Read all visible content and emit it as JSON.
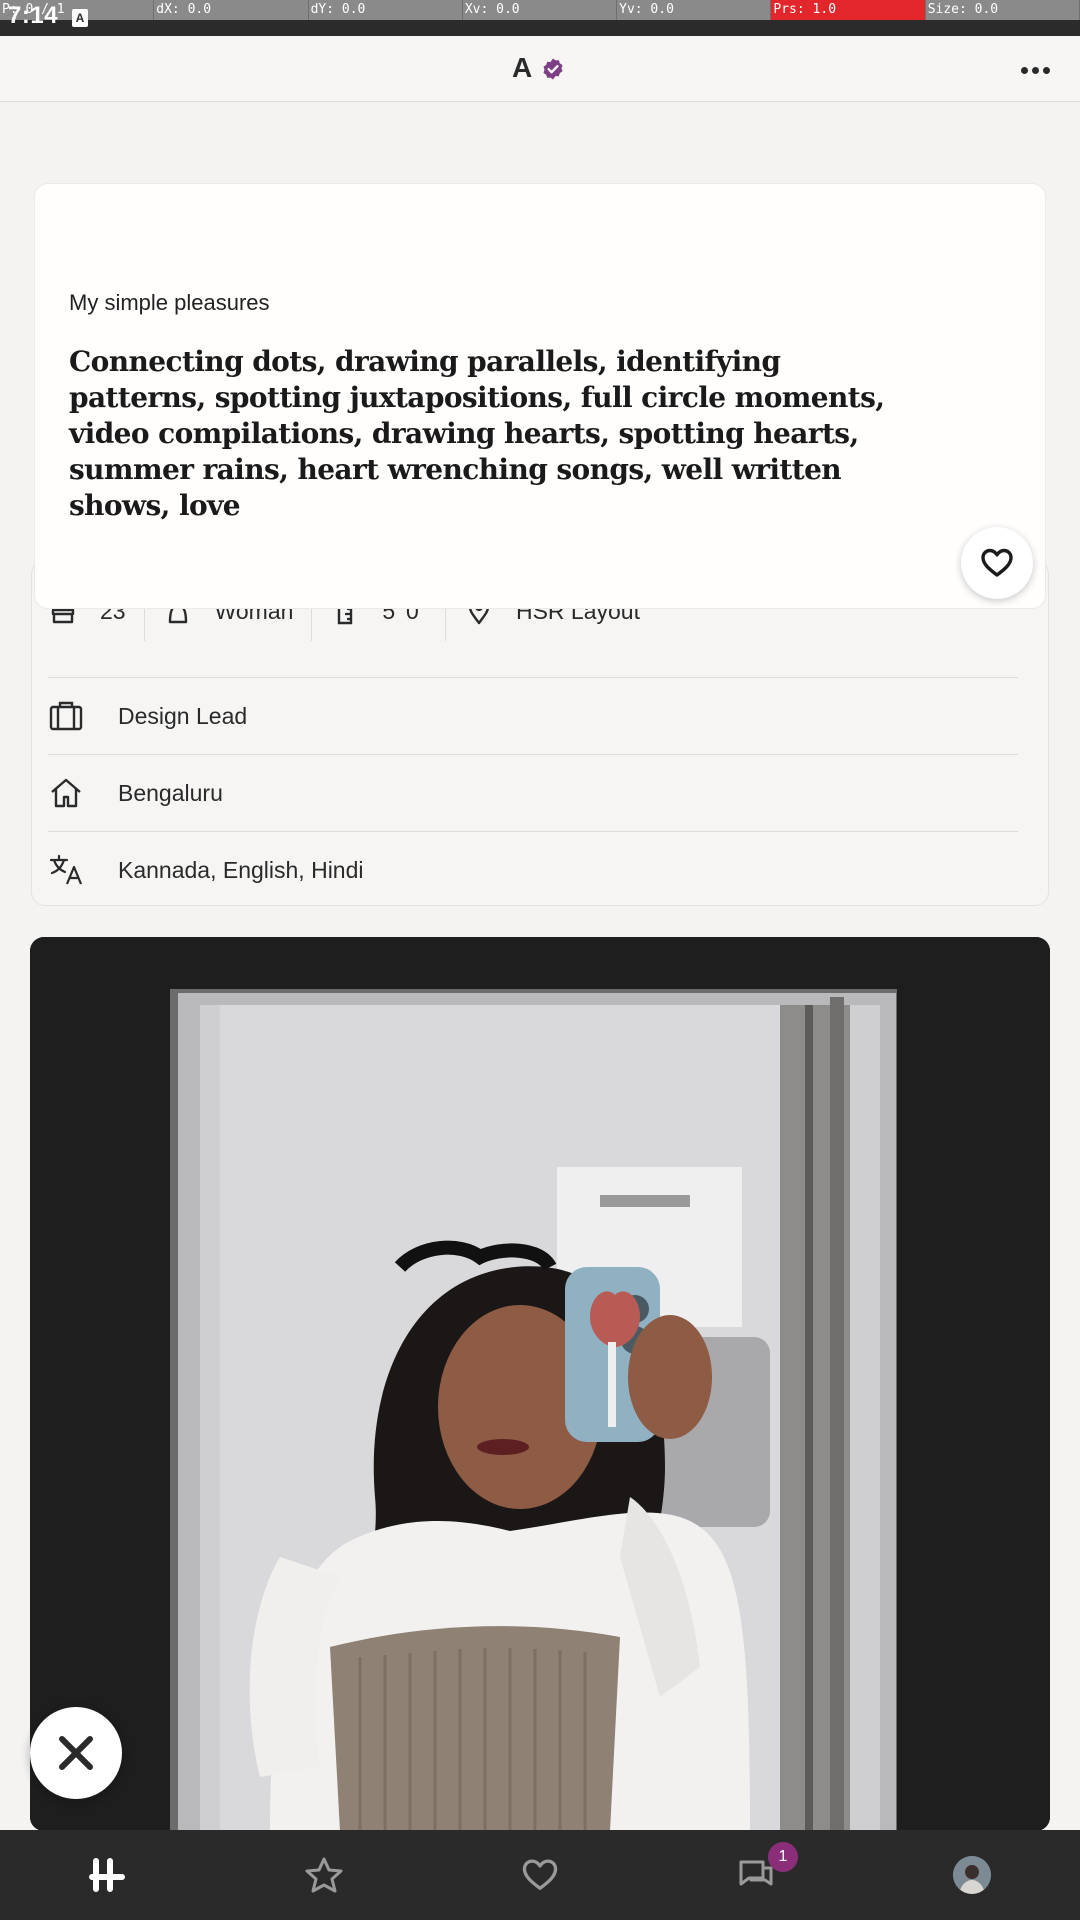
{
  "debug_bar": {
    "cells": [
      "P: 0 / 1",
      "dX: 0.0",
      "dY: 0.0",
      "Xv: 0.0",
      "Yv: 0.0",
      "Prs: 1.0",
      "Size: 0.0"
    ]
  },
  "status_bar": {
    "time": "7:14",
    "notification_badge": "A"
  },
  "header": {
    "profile_name": "A",
    "verified_icon": "verified-badge-icon",
    "menu_icon": "more-horizontal-icon"
  },
  "prompt": {
    "label": "My simple pleasures",
    "answer": "Connecting dots, drawing parallels, identifying patterns, spotting juxtapositions, full circle moments, video compilations, drawing hearts, spotting hearts, summer rains, heart wrenching songs, well written shows, love",
    "like_icon": "heart-outline-icon"
  },
  "vitals": {
    "age": "23",
    "gender": "Woman",
    "height": "5' 0\"",
    "location": "HSR Layout"
  },
  "details": {
    "job": "Design Lead",
    "hometown": "Bengaluru",
    "languages": "Kannada, English, Hindi"
  },
  "photo": {
    "description_icon": "profile-photo"
  },
  "actions": {
    "skip_icon": "close-x-icon"
  },
  "bottom_nav": {
    "items": [
      "home-logo-icon",
      "standouts-star-icon",
      "likes-heart-icon",
      "chat-bubble-icon",
      "profile-avatar"
    ],
    "chat_badge": "1"
  },
  "colors": {
    "accent": "#8b2e7a",
    "nav_background": "#2a2a2a",
    "page_background": "#f4f3f2"
  }
}
